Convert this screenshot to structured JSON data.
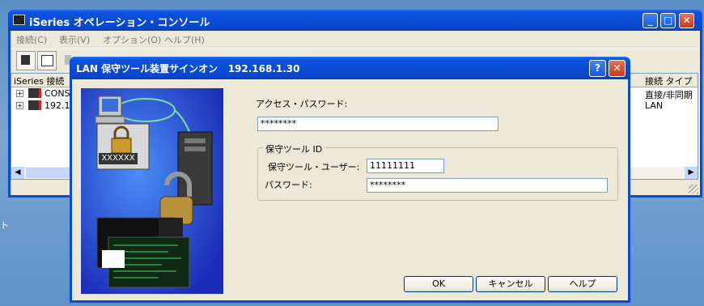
{
  "main_window": {
    "title": "iSeries オペレーション・コンソール",
    "menu": [
      "接続(C)",
      "表示(V)",
      "オプション(O)",
      "ヘルプ(H)"
    ],
    "list": {
      "col1_header": "iSeries 接続",
      "col2_header": "接続 タイプ",
      "rows": [
        {
          "name": "CONS",
          "type": "直接/非同期"
        },
        {
          "name": "192.16",
          "type": "LAN"
        }
      ]
    }
  },
  "desktop_left_text": "ト",
  "dialog": {
    "title": "LAN 保守ツール装置サインオン   192.168.1.30",
    "access_password_label": "アクセス・パスワード:",
    "access_password_value": "********",
    "group_label": "保守ツール ID",
    "user_label": "保守ツール・ユーザー:",
    "user_value": "11111111",
    "password_label": "パスワード:",
    "password_value": "********",
    "ok_label": "OK",
    "cancel_label": "キャンセル",
    "help_label": "ヘルプ",
    "illustration_badge": "XXXXXX"
  }
}
